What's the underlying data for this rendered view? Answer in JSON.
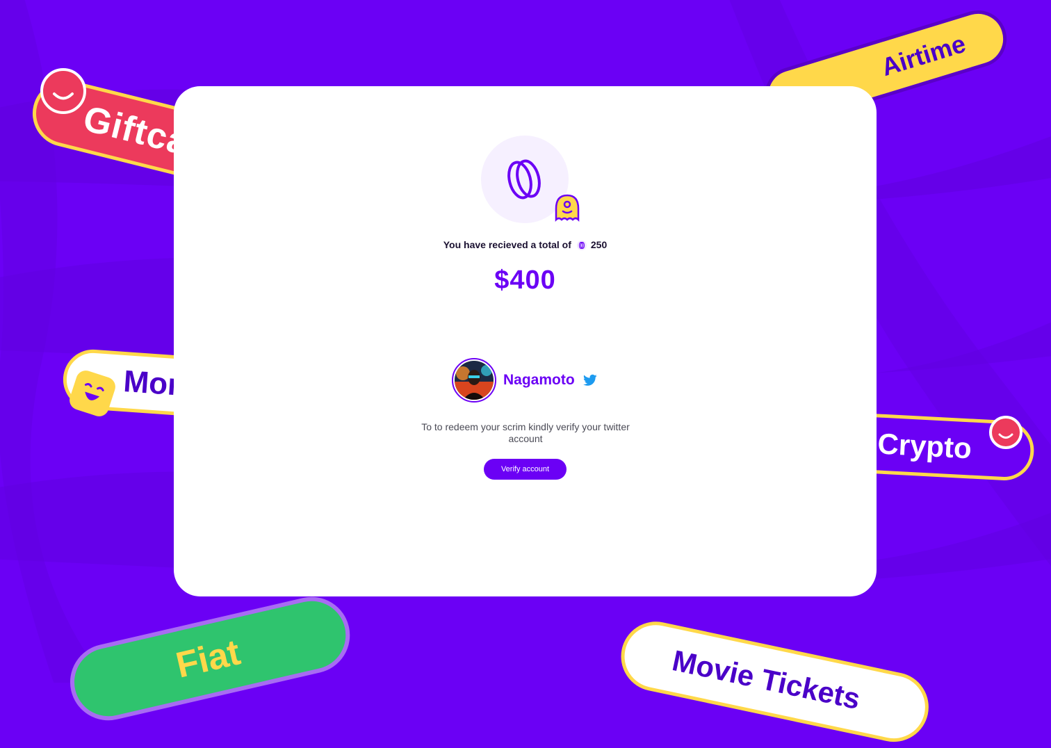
{
  "background": {
    "color": "#6b00f5",
    "pills": {
      "giftcard": "Giftcard",
      "money": "Money",
      "airtime": "Airtime",
      "crypto": "Crypto",
      "fiat": "Fiat",
      "movie_tickets": "Movie Tickets"
    }
  },
  "card": {
    "total_prefix": "You have recieved a total of",
    "total_scrim": "250",
    "amount": "$400",
    "user": {
      "username": "Nagamoto",
      "social_icon": "twitter-icon"
    },
    "instruction": "To to redeem your scrim kindly verify your twitter account",
    "verify_label": "Verify account"
  },
  "colors": {
    "brand_purple": "#6b00f5",
    "accent_yellow": "#ffd84a",
    "accent_red": "#ec3a5c",
    "accent_green": "#2fc46e",
    "twitter_blue": "#1d9bf0"
  }
}
